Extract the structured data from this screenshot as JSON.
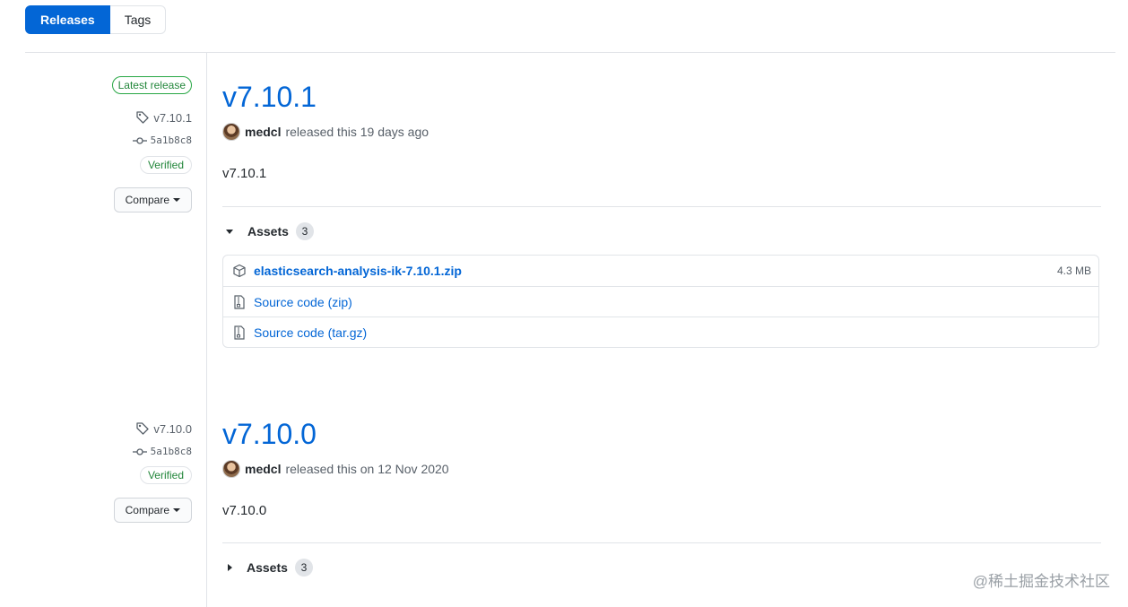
{
  "subnav": {
    "releases_label": "Releases",
    "tags_label": "Tags"
  },
  "releases": [
    {
      "latest_badge": "Latest release",
      "tag": "v7.10.1",
      "commit": "5a1b8c8",
      "verified": "Verified",
      "compare_label": "Compare",
      "title": "v7.10.1",
      "author": "medcl",
      "released_text": "released this 19 days ago",
      "description": "v7.10.1",
      "assets_label": "Assets",
      "assets_count": "3",
      "assets": [
        {
          "name": "elasticsearch-analysis-ik-7.10.1.zip",
          "size": "4.3 MB",
          "icon": "package-icon"
        },
        {
          "name": "Source code",
          "suffix": "(zip)",
          "icon": "file-zip-icon"
        },
        {
          "name": "Source code",
          "suffix": "(tar.gz)",
          "icon": "file-zip-icon"
        }
      ]
    },
    {
      "tag": "v7.10.0",
      "commit": "5a1b8c8",
      "verified": "Verified",
      "compare_label": "Compare",
      "title": "v7.10.0",
      "author": "medcl",
      "released_text": "released this on 12 Nov 2020",
      "description": "v7.10.0",
      "assets_label": "Assets",
      "assets_count": "3"
    }
  ],
  "watermark": "@稀土掘金技术社区",
  "colors": {
    "accent": "#0366d6",
    "verified": "#22863a",
    "border": "#e1e4e8"
  }
}
